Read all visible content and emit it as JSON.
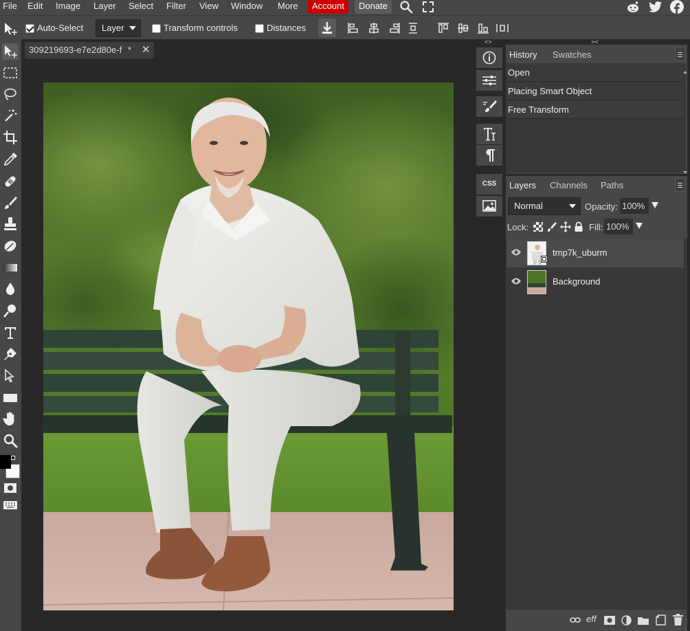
{
  "menu": {
    "items": [
      "File",
      "Edit",
      "Image",
      "Layer",
      "Select",
      "Filter",
      "View",
      "Window",
      "More"
    ],
    "account": "Account",
    "donate": "Donate",
    "account_color": "#cc0000",
    "donate_color": "#5a5a5a"
  },
  "options": {
    "auto_select_label": "Auto-Select",
    "auto_select_checked": true,
    "target_value": "Layer",
    "transform_controls_label": "Transform controls",
    "transform_controls_checked": false,
    "distances_label": "Distances",
    "distances_checked": false
  },
  "document": {
    "tab_title": "309219693-e7e2d80e-f",
    "modified_mark": "*"
  },
  "panels": {
    "history": {
      "tabs": [
        "History",
        "Swatches"
      ],
      "entries": [
        "Open",
        "Placing Smart Object",
        "Free Transform"
      ]
    },
    "layers": {
      "tabs": [
        "Layers",
        "Channels",
        "Paths"
      ],
      "blend_mode": "Normal",
      "opacity_label": "Opacity:",
      "opacity_value": "100%",
      "lock_label": "Lock:",
      "fill_label": "Fill:",
      "fill_value": "100%",
      "layers": [
        "tmp7k_uburm",
        "Background"
      ],
      "footer_eff": "eff"
    },
    "side_buttons": {
      "css": "CSS"
    }
  },
  "colors": {
    "chrome": "#474747",
    "background": "#282828",
    "foreground_swatch": "#000000",
    "background_swatch": "#ffffff"
  }
}
